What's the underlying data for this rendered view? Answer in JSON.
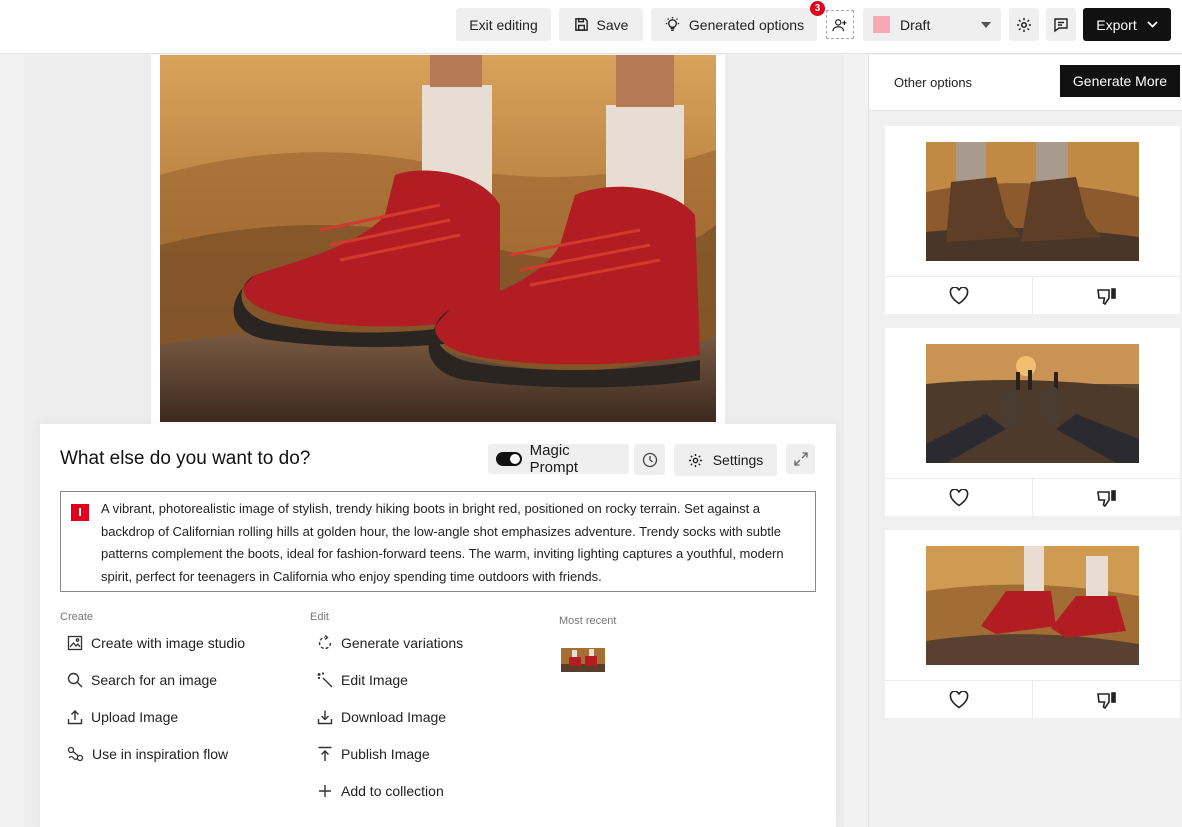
{
  "toolbar": {
    "exit_label": "Exit editing",
    "save_label": "Save",
    "generated_label": "Generated options",
    "notification_count": "3",
    "status_value": "Draft",
    "status_color": "#f7a9b5",
    "export_label": "Export"
  },
  "prompt_panel": {
    "title": "What else do you want to do?",
    "magic_prompt_label": "Magic Prompt",
    "settings_label": "Settings",
    "prompt_text": "A vibrant, photorealistic image of stylish, trendy hiking boots in bright red, positioned on rocky terrain. Set against a backdrop of Californian rolling hills at golden hour, the low-angle shot emphasizes adventure. Trendy socks with subtle patterns complement the boots, ideal for fashion-forward teens. The warm, inviting lighting captures a youthful, modern spirit, perfect for teenagers in California who enjoy spending time outdoors with friends."
  },
  "create": {
    "label": "Create",
    "items": [
      {
        "label": "Create with image studio",
        "icon": "image-studio-icon"
      },
      {
        "label": "Search for an image",
        "icon": "search-icon"
      },
      {
        "label": "Upload Image",
        "icon": "upload-icon"
      },
      {
        "label": "Use in inspiration flow",
        "icon": "inspiration-flow-icon"
      }
    ]
  },
  "edit": {
    "label": "Edit",
    "items": [
      {
        "label": "Generate variations",
        "icon": "variations-icon"
      },
      {
        "label": "Edit Image",
        "icon": "magic-wand-icon"
      },
      {
        "label": "Download Image",
        "icon": "download-icon"
      },
      {
        "label": "Publish Image",
        "icon": "publish-icon"
      },
      {
        "label": "Add to collection",
        "icon": "plus-icon"
      }
    ]
  },
  "recent": {
    "label": "Most recent"
  },
  "sidebar": {
    "title": "Other options",
    "generate_more_label": "Generate More"
  },
  "colors": {
    "accent_red": "#e0001b",
    "dark": "#111111"
  }
}
